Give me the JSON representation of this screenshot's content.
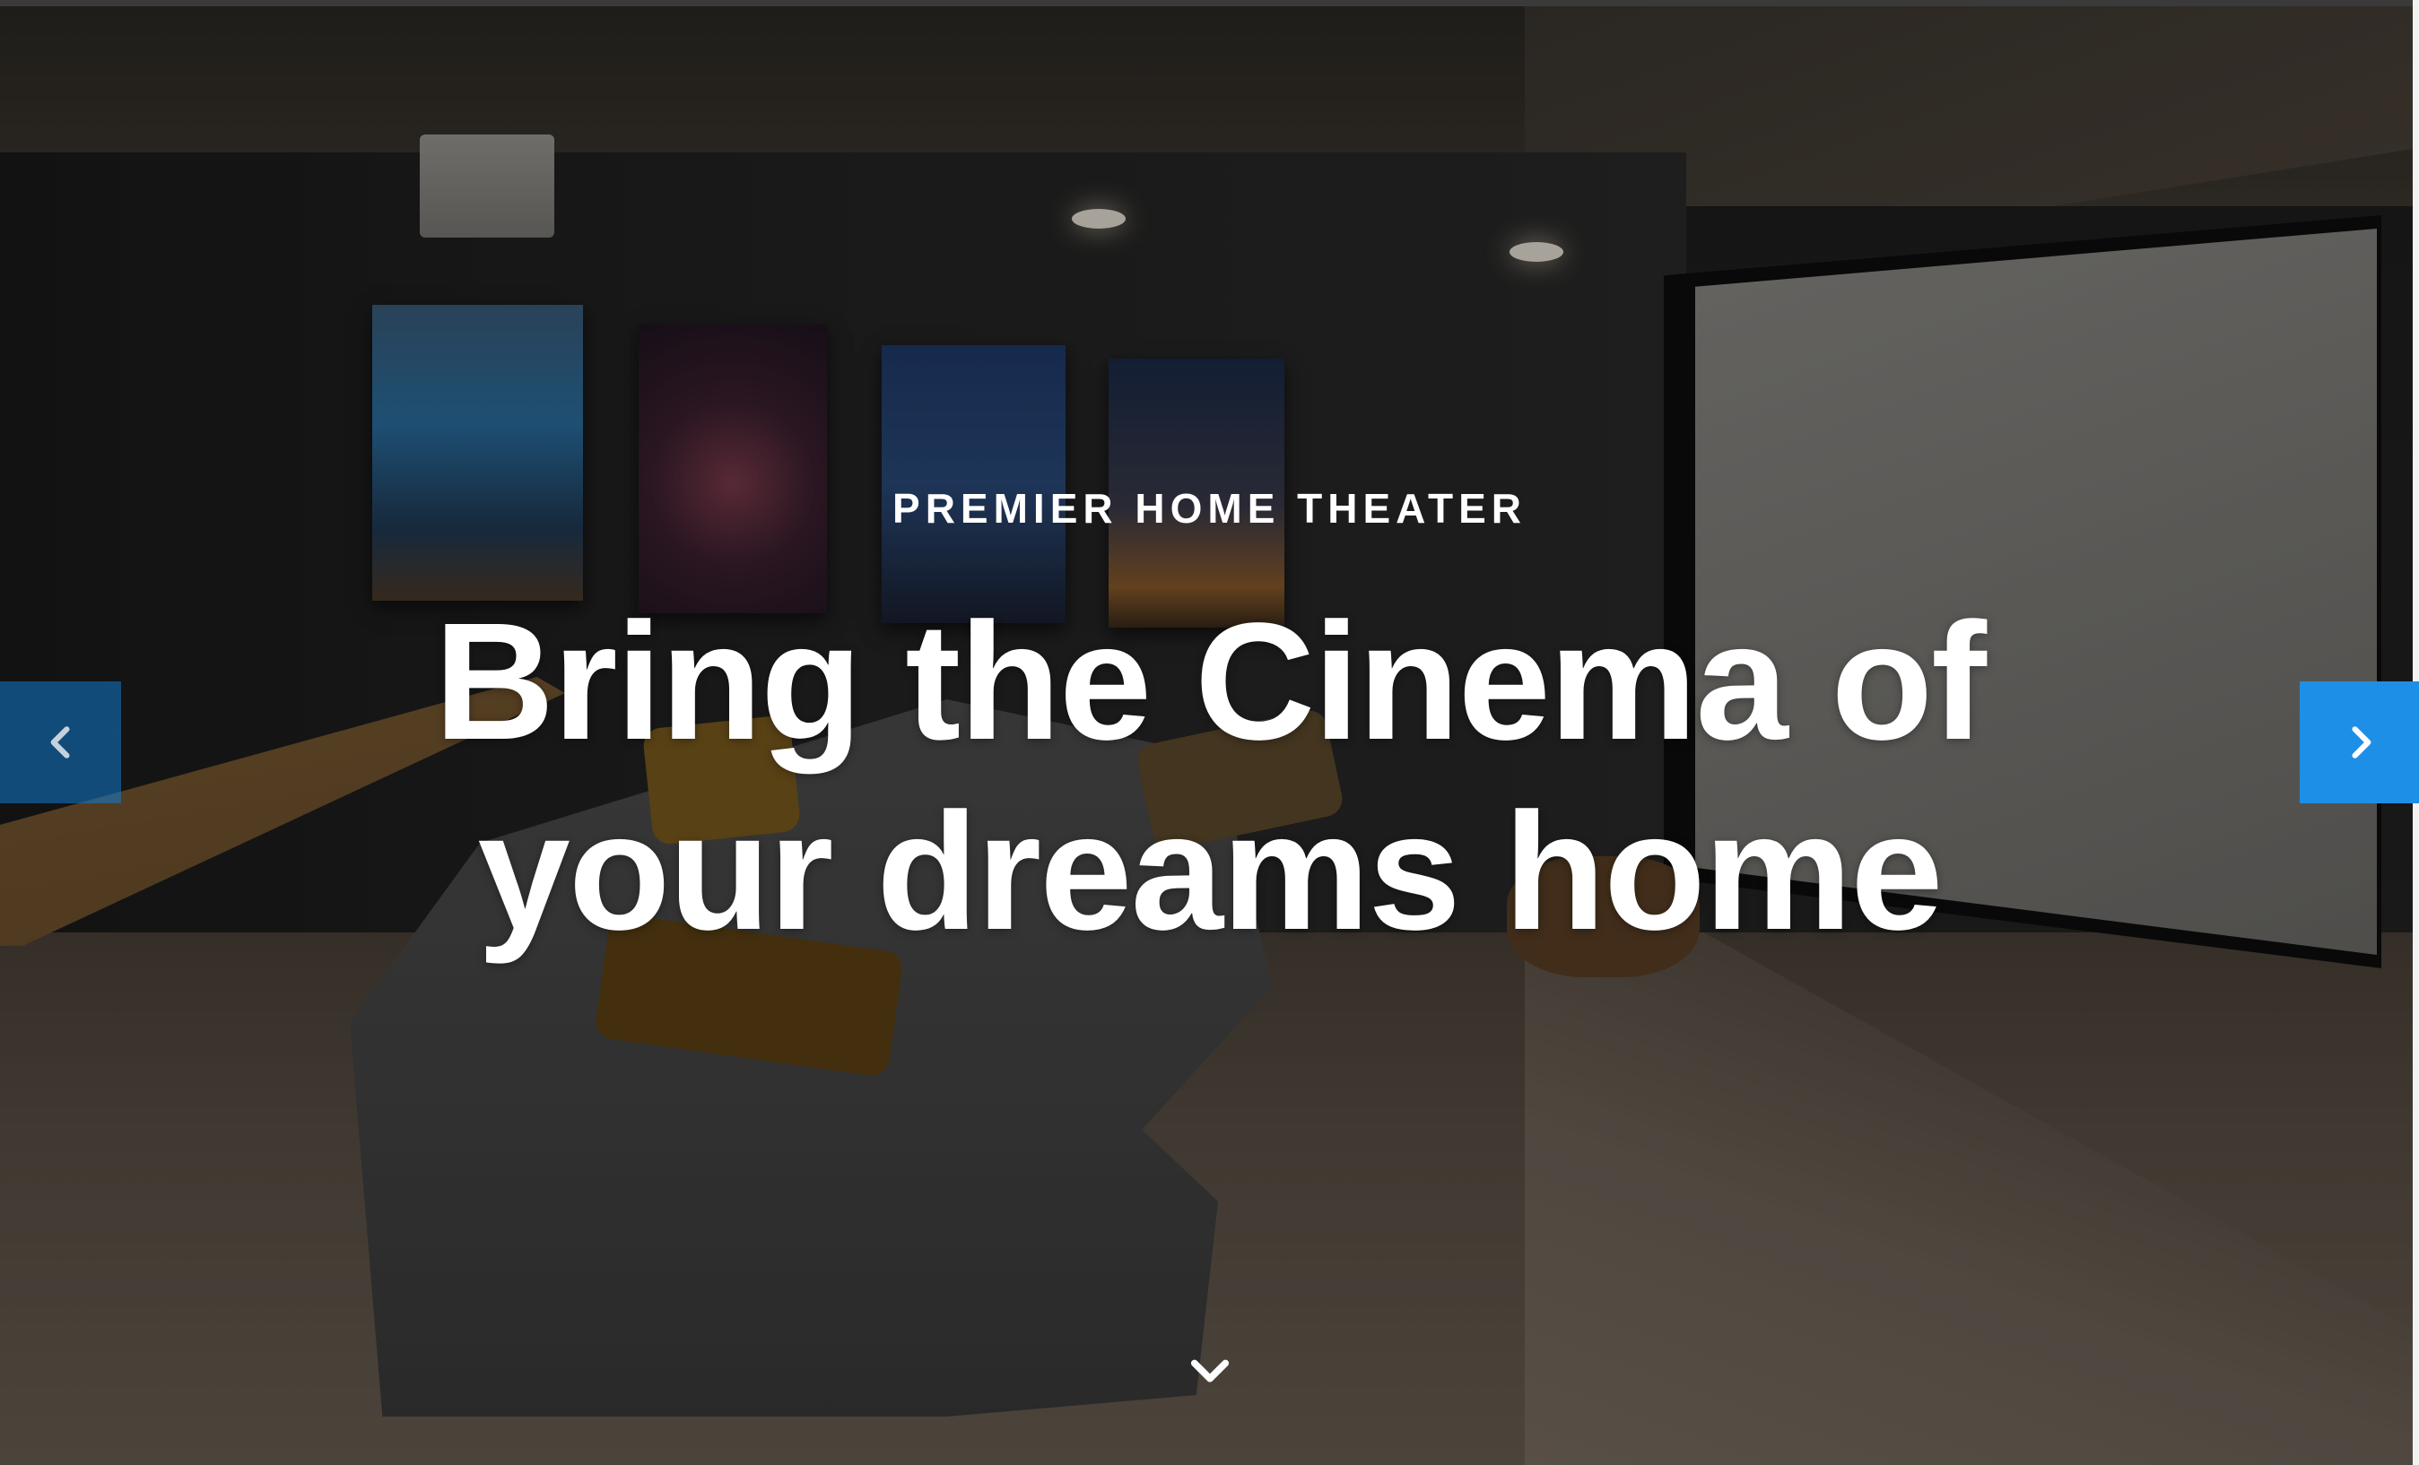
{
  "hero": {
    "eyebrow": "PREMIER HOME THEATER",
    "headline_line1": "Bring the Cinema of",
    "headline_line2": "your dreams home"
  },
  "carousel": {
    "prev_icon": "chevron-left-icon",
    "next_icon": "chevron-right-icon",
    "prev_color": "#117acf",
    "next_color": "#1e8fe6"
  },
  "scroll": {
    "icon": "chevron-down-icon"
  },
  "colors": {
    "text": "#ffffff",
    "accent": "#1e8fe6"
  }
}
